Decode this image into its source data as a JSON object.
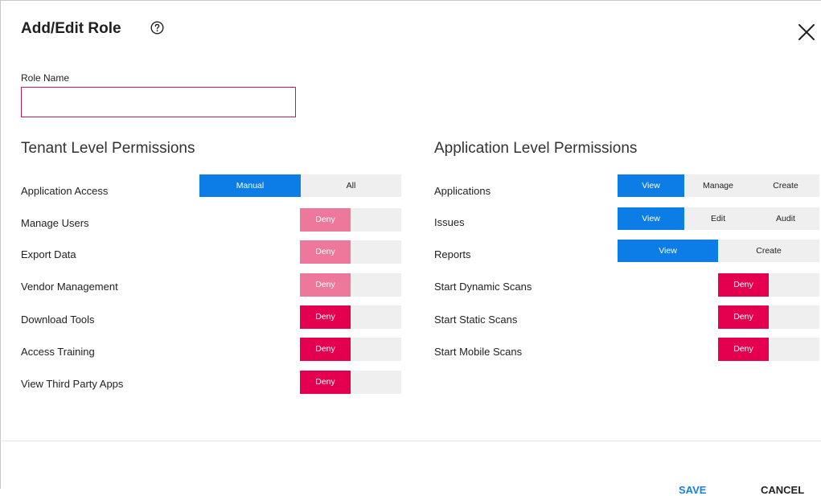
{
  "dialog": {
    "title": "Add/Edit Role",
    "help_icon": "question-circle-icon",
    "close_icon": "close-x-icon"
  },
  "role_name": {
    "label": "Role Name",
    "value": "",
    "placeholder": ""
  },
  "tenant": {
    "title": "Tenant Level Permissions",
    "rows": [
      {
        "label": "Application Access",
        "options": [
          "Manual",
          "All"
        ],
        "selected": "Manual"
      },
      {
        "label": "Manage Users",
        "toggle": "Deny",
        "state": "disabled"
      },
      {
        "label": "Export Data",
        "toggle": "Deny",
        "state": "disabled"
      },
      {
        "label": "Vendor Management",
        "toggle": "Deny",
        "state": "disabled"
      },
      {
        "label": "Download Tools",
        "toggle": "Deny",
        "state": "active"
      },
      {
        "label": "Access Training",
        "toggle": "Deny",
        "state": "active"
      },
      {
        "label": "View Third Party Apps",
        "toggle": "Deny",
        "state": "active"
      }
    ]
  },
  "application": {
    "title": "Application Level Permissions",
    "rows": [
      {
        "label": "Applications",
        "options": [
          "View",
          "Manage",
          "Create"
        ],
        "selected": "View"
      },
      {
        "label": "Issues",
        "options": [
          "View",
          "Edit",
          "Audit"
        ],
        "selected": "View"
      },
      {
        "label": "Reports",
        "options": [
          "View",
          "Create"
        ],
        "selected": "View"
      },
      {
        "label": "Start Dynamic Scans",
        "toggle": "Deny",
        "state": "active"
      },
      {
        "label": "Start Static Scans",
        "toggle": "Deny",
        "state": "active"
      },
      {
        "label": "Start Mobile Scans",
        "toggle": "Deny",
        "state": "active"
      }
    ]
  },
  "footer": {
    "save_label": "SAVE",
    "cancel_label": "CANCEL"
  },
  "colors": {
    "accent_blue": "#0c7ce6",
    "deny_active": "#e4004f",
    "deny_disabled": "#ee789c",
    "input_border": "#c2185b"
  }
}
